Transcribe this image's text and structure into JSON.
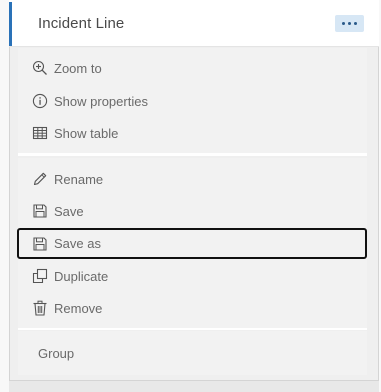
{
  "layer_panel": {
    "title": "Incident Line",
    "more_button_label": "···",
    "group_label": "Group"
  },
  "menu": {
    "section1": [
      {
        "label": "Zoom to",
        "icon": "zoom-in-icon"
      },
      {
        "label": "Show properties",
        "icon": "info-icon"
      },
      {
        "label": "Show table",
        "icon": "table-icon"
      }
    ],
    "section2": [
      {
        "label": "Rename",
        "icon": "pencil-icon"
      },
      {
        "label": "Save",
        "icon": "save-icon"
      },
      {
        "label": "Save as",
        "icon": "save-as-icon",
        "focused": true
      },
      {
        "label": "Duplicate",
        "icon": "duplicate-icon"
      },
      {
        "label": "Remove",
        "icon": "trash-icon"
      }
    ]
  },
  "colors": {
    "accent": "#2a72b8",
    "more_button_bg": "#d7e7f5",
    "focus_outline": "#111111",
    "text": "#6a6a6a"
  }
}
